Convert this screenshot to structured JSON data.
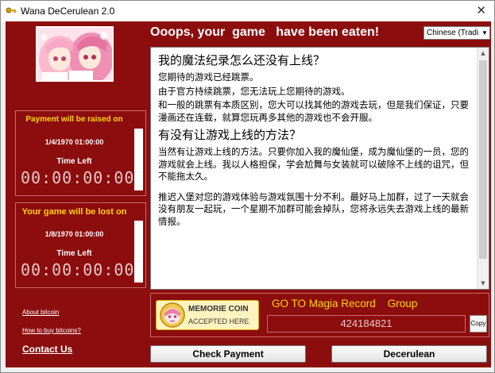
{
  "window": {
    "title": "Wana DeCerulean 2.0",
    "close_glyph": "✕"
  },
  "header": {
    "headline": "Ooops, your  game   have been eaten!"
  },
  "language": {
    "selected": "Chinese (Tradi",
    "arrow": "▼"
  },
  "timers": [
    {
      "heading": "Payment will be raised on",
      "date": "1/4/1970 01:00:00",
      "time_left_label": "Time Left",
      "countdown": "00:00:00:00"
    },
    {
      "heading": "Your  game  will be lost on",
      "date": "1/8/1970 01:00:00",
      "time_left_label": "Time Left",
      "countdown": "00:00:00:00"
    }
  ],
  "links": {
    "about": "About bitcoin",
    "how_to_buy": "How to buy bitcoins?",
    "contact": "Contact Us"
  },
  "message": {
    "heading1": "我的魔法纪录怎么还没有上线？",
    "para1_line1": "您期待的游戏已经跳票。",
    "para1_line2": "由于官方持续跳票，您无法玩上您期待的游戏。",
    "para1_line3": "和一般的跳票有本质区别，您大可以找其他的游戏去玩，但是我们保证，只要漫画还在连载，就算您玩再多其他的游戏也不会开服。",
    "heading2": "有没有让游戏上线的方法？",
    "para2": "当然有让游戏上线的方法。只要你加入我的魔仙堡，成为魔仙堡的一员，您的游戏就会上线。我以人格担保，学会尬舞与女装就可以破除不上线的诅咒，但不能拖太久。",
    "para3": "推迟入堡对您的游戏体验与游戏氛围十分不利。最好马上加群，过了一天就会没有朋友一起玩，一个星期不加群可能会掉队，您将永远失去游戏上线的最新情报。"
  },
  "payment": {
    "coin_line1": "MEMORIE COIN",
    "coin_line2": "ACCEPTED  HERE",
    "goto_text": "GO TO Magia Record    Group",
    "address": "424184821",
    "copy_label": "Copy"
  },
  "buttons": {
    "check_payment": "Check Payment",
    "decrypt": "Decerulean"
  },
  "colors": {
    "background_red": "#8c0d0d",
    "accent_yellow": "#ffd400",
    "digit_color": "#e8c8c8"
  },
  "icons": {
    "app_icon": "key-icon",
    "avatar": "anime-girls-avatar",
    "coin": "pink-hair-girl-coin-icon"
  }
}
